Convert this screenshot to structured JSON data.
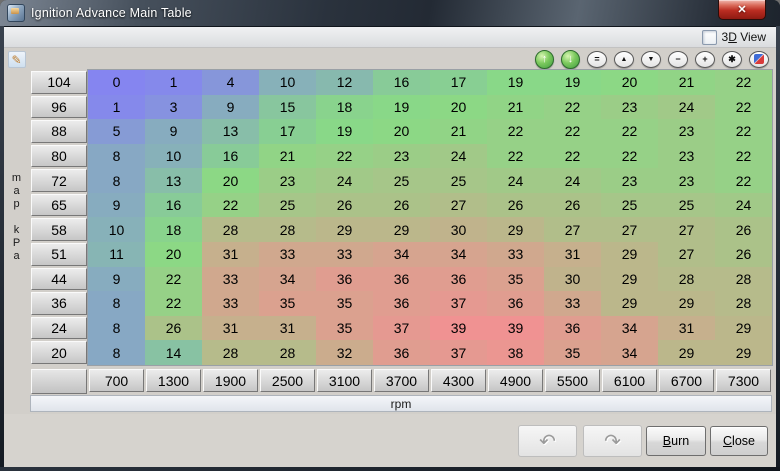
{
  "window": {
    "title": "Ignition Advance Main Table",
    "close_glyph": "✕"
  },
  "options": {
    "view3d": {
      "pre": "3",
      "mnemonic": "D",
      "post": " View"
    }
  },
  "panel": {
    "edit_pencil_glyph": "✎"
  },
  "toolbar": {
    "buttons": [
      {
        "name": "raise-values-button",
        "glyph": "↑",
        "style": "green"
      },
      {
        "name": "lower-values-button",
        "glyph": "↓",
        "style": "green"
      },
      {
        "name": "set-equal-button",
        "glyph": "=",
        "style": "oval"
      },
      {
        "name": "increase-step-button",
        "glyph": "▲",
        "style": "oval tri"
      },
      {
        "name": "decrease-step-button",
        "glyph": "▼",
        "style": "oval tri"
      },
      {
        "name": "decrement-button",
        "glyph": "−",
        "style": "oval"
      },
      {
        "name": "increment-button",
        "glyph": "+",
        "style": "oval"
      },
      {
        "name": "scale-button",
        "glyph": "✱",
        "style": "oval"
      },
      {
        "name": "edit-cell-button",
        "glyph": "",
        "style": "pencil"
      }
    ]
  },
  "chart_data": {
    "type": "heatmap",
    "title": "Ignition Advance Main Table",
    "xlabel": "rpm",
    "ylabel": "map kPa",
    "x": [
      700,
      1300,
      1900,
      2500,
      3100,
      3700,
      4300,
      4900,
      5500,
      6100,
      6700,
      7300
    ],
    "y": [
      104,
      96,
      88,
      80,
      72,
      65,
      58,
      51,
      44,
      36,
      24,
      20
    ],
    "values": [
      [
        0,
        1,
        4,
        10,
        12,
        16,
        17,
        19,
        19,
        20,
        21,
        22
      ],
      [
        1,
        3,
        9,
        15,
        18,
        19,
        20,
        21,
        22,
        23,
        24,
        22
      ],
      [
        5,
        9,
        13,
        17,
        19,
        20,
        21,
        22,
        22,
        22,
        23,
        22
      ],
      [
        8,
        10,
        16,
        21,
        22,
        23,
        24,
        22,
        22,
        22,
        23,
        22
      ],
      [
        8,
        13,
        20,
        23,
        24,
        25,
        25,
        24,
        24,
        23,
        23,
        22
      ],
      [
        9,
        16,
        22,
        25,
        26,
        26,
        27,
        26,
        26,
        25,
        25,
        24
      ],
      [
        10,
        18,
        28,
        28,
        29,
        29,
        30,
        29,
        27,
        27,
        27,
        26
      ],
      [
        11,
        20,
        31,
        33,
        33,
        34,
        34,
        33,
        31,
        29,
        27,
        26
      ],
      [
        9,
        22,
        33,
        34,
        36,
        36,
        36,
        35,
        30,
        29,
        28,
        28
      ],
      [
        8,
        22,
        33,
        35,
        35,
        36,
        37,
        36,
        33,
        29,
        29,
        28
      ],
      [
        8,
        26,
        31,
        31,
        35,
        37,
        39,
        39,
        36,
        34,
        31,
        29
      ],
      [
        8,
        14,
        28,
        28,
        32,
        36,
        37,
        38,
        35,
        34,
        29,
        29
      ]
    ],
    "value_min": 0,
    "value_max": 39,
    "colors": {
      "low": "#8585f0",
      "mid": "#89da85",
      "high": "#f09292"
    },
    "y_axis_chars": [
      "m",
      "a",
      "p",
      "",
      "k",
      "P",
      "a"
    ]
  },
  "footer": {
    "undo_glyph": "↶",
    "redo_glyph": "↷",
    "burn": {
      "mnemonic": "B",
      "rest": "urn"
    },
    "close": {
      "mnemonic": "C",
      "rest": "lose"
    }
  }
}
